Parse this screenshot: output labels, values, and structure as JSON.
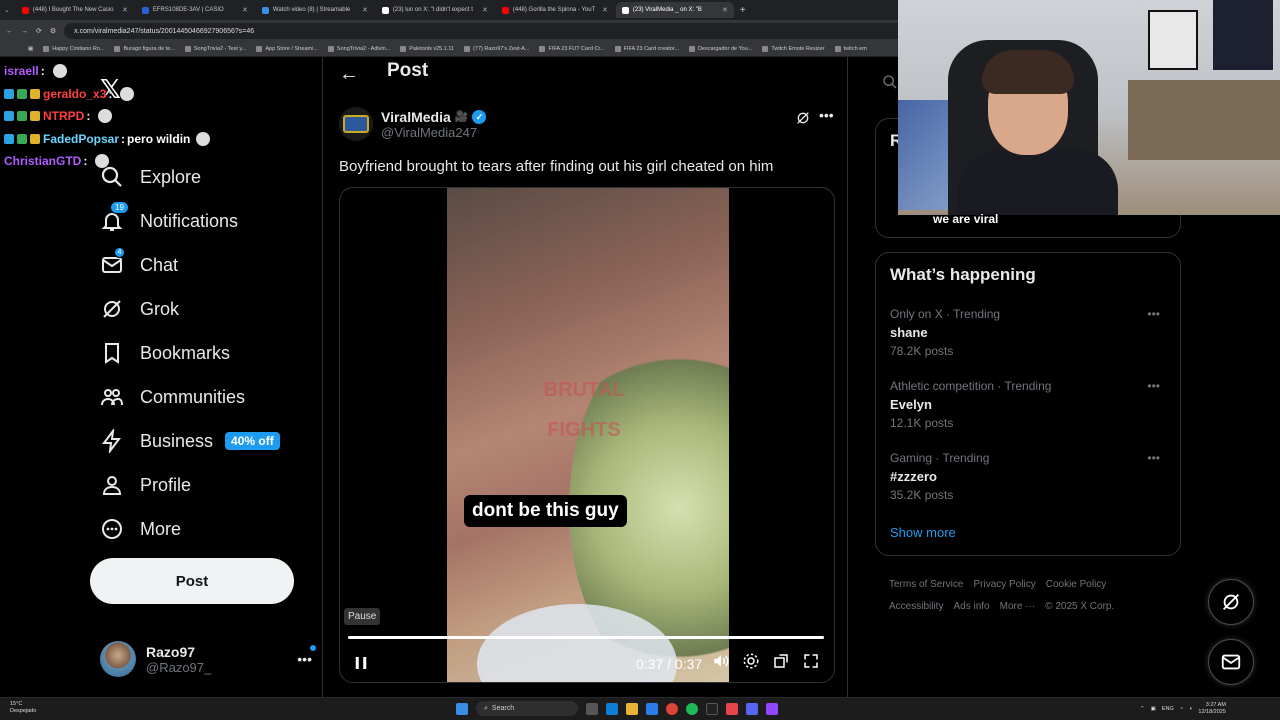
{
  "browser": {
    "tabs": [
      {
        "label": "(448) I Bought The New Casio",
        "color": "#ff0000",
        "active": false
      },
      {
        "label": "EFRS108DE-3AV | CASIO",
        "color": "#2b5fd9",
        "active": false
      },
      {
        "label": "Watch video (8) | Streamable",
        "color": "#3a8ee6",
        "active": false
      },
      {
        "label": "(23) lun on X: \"I didn't expect t",
        "color": "#ffffff",
        "active": false
      },
      {
        "label": "(448) Gorilla the Spinna - YouT",
        "color": "#ff0000",
        "active": false
      },
      {
        "label": "(23) ViralMedia _ on X: \"B",
        "color": "#ffffff",
        "active": true
      }
    ],
    "url": "x.com/viralmedia247/status/2001445046692790656?s=46",
    "bookmarks": [
      "Happy Cristiano Ro...",
      "Burago figura de te...",
      "SongTrivia2 - Test y...",
      "App Store / Streami...",
      "SongTrivia2 - Adivin...",
      "Paletools v25.1.11",
      "(77) Razo97's Zest-A...",
      "FIFA 23 FUT Card Cr...",
      "FIFA 23 Card creator...",
      "Descargador de You...",
      "Twitch Emote Resizer",
      "twitch em"
    ]
  },
  "chat": [
    {
      "user": "israell",
      "color": "#b05cff",
      "msg": ""
    },
    {
      "user": "geraldo_x3",
      "color": "#ff4040",
      "msg": ""
    },
    {
      "user": "NTRPD",
      "color": "#ff4040",
      "msg": ""
    },
    {
      "user": "FadedPopsar",
      "color": "#6cd6ff",
      "msg": "pero wildin"
    },
    {
      "user": "ChristianGTD",
      "color": "#b05cff",
      "msg": ""
    }
  ],
  "sidebar": {
    "items": [
      {
        "label": "Explore",
        "icon": "search-icon"
      },
      {
        "label": "Notifications",
        "icon": "bell-icon",
        "badge": "19"
      },
      {
        "label": "Chat",
        "icon": "mail-icon",
        "badge": "4"
      },
      {
        "label": "Grok",
        "icon": "grok-icon"
      },
      {
        "label": "Bookmarks",
        "icon": "bookmark-icon"
      },
      {
        "label": "Communities",
        "icon": "communities-icon"
      },
      {
        "label": "Business",
        "icon": "lightning-icon",
        "promo": "40% off"
      },
      {
        "label": "Profile",
        "icon": "person-icon"
      },
      {
        "label": "More",
        "icon": "more-circle-icon"
      }
    ],
    "post_button": "Post",
    "account": {
      "name": "Razo97",
      "handle": "@Razo97_"
    }
  },
  "main": {
    "title": "Post",
    "author": {
      "name": "ViralMedia",
      "emoji": "🎥",
      "handle": "@ViralMedia247"
    },
    "text": "Boyfriend brought to tears after finding out his girl cheated on him",
    "video": {
      "watermark": "BRUTAL FIGHTS",
      "caption": "dont be this guy",
      "tooltip": "Pause",
      "time": "0:37 / 0:37",
      "progress": 1.0
    }
  },
  "right": {
    "letter": "R",
    "happening_title": "What’s happening",
    "trends": [
      {
        "context": "Only on X · Trending",
        "name": "shane",
        "count": "78.2K posts"
      },
      {
        "context": "Athletic competition · Trending",
        "name": "Evelyn",
        "count": "12.1K posts"
      },
      {
        "context": "Gaming · Trending",
        "name": "#zzzero",
        "count": "35.2K posts"
      }
    ],
    "show_more": "Show more",
    "footer": [
      "Terms of Service",
      "Privacy Policy",
      "Cookie Policy",
      "Accessibility",
      "Ads info",
      "More ···",
      "© 2025 X Corp."
    ]
  },
  "webcam": {
    "overlay_text": "we are viral"
  },
  "taskbar": {
    "weather_temp": "15°C",
    "weather_desc": "Despejado",
    "search": "Search",
    "lang": "ENG",
    "time": "3:27 AM",
    "date": "12/18/2025"
  }
}
